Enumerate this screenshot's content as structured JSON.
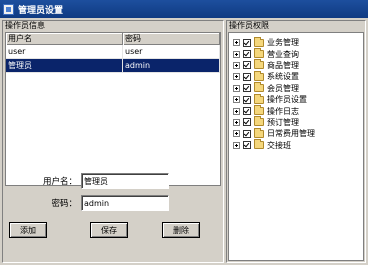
{
  "window": {
    "title": "管理员设置",
    "icon": "app-icon"
  },
  "left_panel": {
    "title": "操作员信息",
    "table": {
      "columns": [
        "用户名",
        "密码"
      ],
      "rows": [
        {
          "username": "user",
          "password": "user",
          "selected": false
        },
        {
          "username": "管理员",
          "password": "admin",
          "selected": true
        }
      ]
    },
    "form": {
      "username_label": "用户名：",
      "username_value": "管理员",
      "password_label": "密码：",
      "password_value": "admin"
    },
    "buttons": {
      "add": "添加",
      "save": "保存",
      "delete": "删除"
    }
  },
  "right_panel": {
    "title": "操作员权限",
    "tree": [
      {
        "label": "业务管理",
        "checked": true,
        "icon": "folder-icon"
      },
      {
        "label": "营业查询",
        "checked": true,
        "icon": "folder-icon"
      },
      {
        "label": "商品管理",
        "checked": true,
        "icon": "folder-icon"
      },
      {
        "label": "系统设置",
        "checked": true,
        "icon": "folder-icon"
      },
      {
        "label": "会员管理",
        "checked": true,
        "icon": "folder-icon"
      },
      {
        "label": "操作员设置",
        "checked": true,
        "icon": "folder-icon"
      },
      {
        "label": "操作日志",
        "checked": true,
        "icon": "folder-icon"
      },
      {
        "label": "预订管理",
        "checked": true,
        "icon": "folder-icon"
      },
      {
        "label": "日常费用管理",
        "checked": true,
        "icon": "folder-icon"
      },
      {
        "label": "交接班",
        "checked": true,
        "icon": "folder-icon"
      }
    ]
  }
}
